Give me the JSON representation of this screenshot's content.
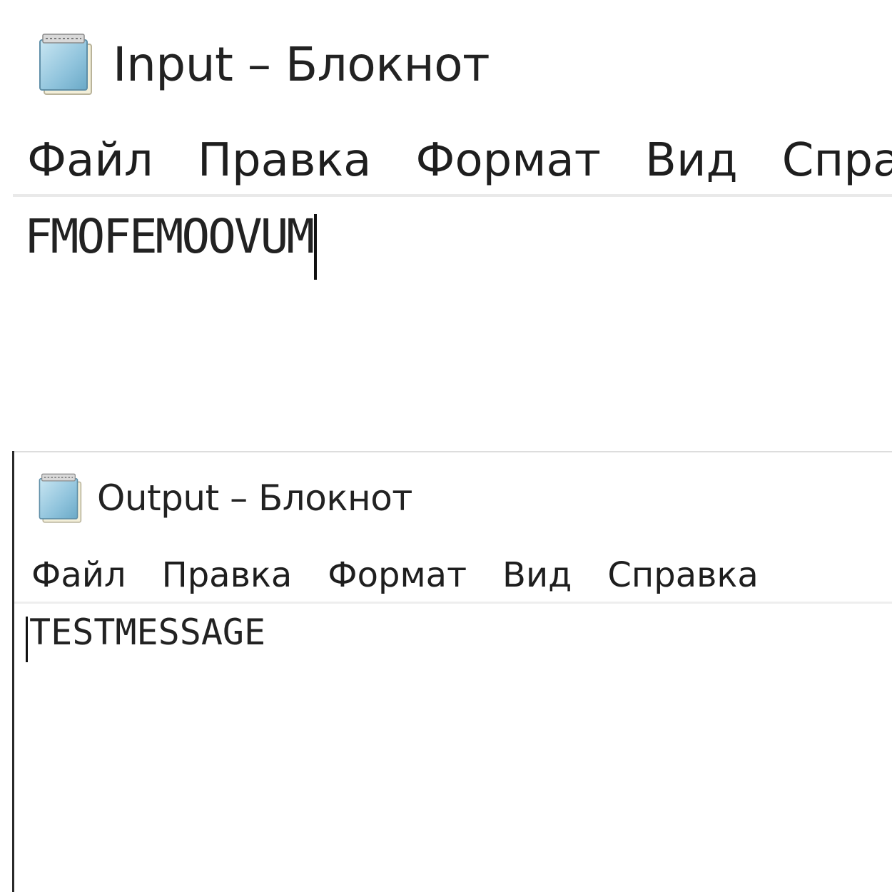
{
  "windows": [
    {
      "title": "Input – Блокнот",
      "icon": "notepad-icon",
      "menu": [
        "Файл",
        "Правка",
        "Формат",
        "Вид",
        "Справка"
      ],
      "content": "FMOFEMOOVUM",
      "caret_position": "end"
    },
    {
      "title": "Output – Блокнот",
      "icon": "notepad-icon",
      "menu": [
        "Файл",
        "Правка",
        "Формат",
        "Вид",
        "Справка"
      ],
      "content": "TESTMESSAGE",
      "caret_position": "start"
    }
  ],
  "colors": {
    "background": "#ffffff",
    "text": "#1a1a1a",
    "icon_blue": "#8fc3dc",
    "icon_page": "#f1eed8"
  }
}
